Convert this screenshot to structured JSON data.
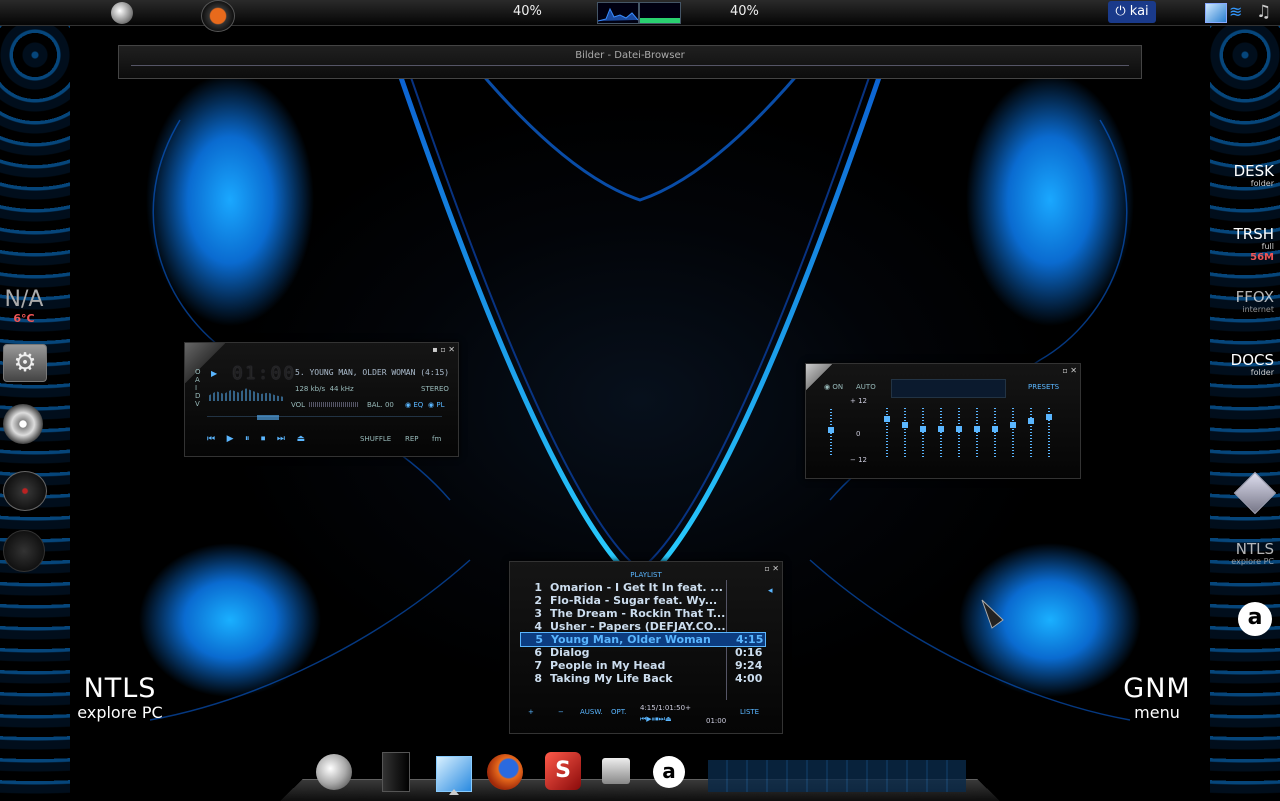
{
  "top_panel": {
    "cpu_left_percent": "40%",
    "cpu_right_percent": "40%",
    "user_name": "kai",
    "icons": [
      "swirl-logo-icon",
      "ubuntu-logo-icon",
      "power-icon",
      "network-icon",
      "wifi-icon",
      "music-icon"
    ]
  },
  "file_browser": {
    "title": "Bilder - Datei-Browser"
  },
  "left_labels": {
    "weather_temp": "N/A",
    "weather_deg": "6°C",
    "ntls_big": "NTLS",
    "ntls_small": "explore PC"
  },
  "right_labels": {
    "gnm_big": "GNM",
    "gnm_small": "menu",
    "ntls_big": "NTLS",
    "ntls_small": "explore PC"
  },
  "right_icons": [
    {
      "big": "DESK",
      "small": "folder"
    },
    {
      "big": "TRSH",
      "small": "full",
      "extra": "56M"
    },
    {
      "big": "FFOX",
      "small": "internet"
    },
    {
      "big": "DOCS",
      "small": "folder"
    }
  ],
  "player": {
    "time": "01:00",
    "track": "5. YOUNG MAN, OLDER WOMAN (4:15)",
    "bitrate": "128",
    "bitrate_unit": "kb/s",
    "khz": "44",
    "khz_unit": "kHz",
    "stereo": "STEREO",
    "vol_label": "VOL",
    "bal_label": "BAL",
    "bal_value": "00",
    "eq_btn": "EQ",
    "pl_btn": "PL",
    "shuffle": "SHUFFLE",
    "rep": "REP"
  },
  "equalizer": {
    "on": "ON",
    "auto": "AUTO",
    "presets": "PRESETS",
    "plus": "+ 12",
    "zero": "0",
    "minus": "− 12"
  },
  "playlist": {
    "title": "PLAYLIST",
    "items": [
      {
        "n": "1",
        "title": "Omarion - I Get It In feat. ...",
        "dur": ""
      },
      {
        "n": "2",
        "title": "Flo-Rida - Sugar feat. Wy...",
        "dur": ""
      },
      {
        "n": "3",
        "title": "The Dream - Rockin That T...",
        "dur": ""
      },
      {
        "n": "4",
        "title": "Usher - Papers (DEFJAY.CO...",
        "dur": ""
      },
      {
        "n": "5",
        "title": "Young Man, Older Woman",
        "dur": "4:15"
      },
      {
        "n": "6",
        "title": "Dialog",
        "dur": "0:16"
      },
      {
        "n": "7",
        "title": "People in My Head",
        "dur": "9:24"
      },
      {
        "n": "8",
        "title": "Taking My Life Back",
        "dur": "4:00"
      }
    ],
    "btn_add": "+",
    "btn_rem": "−",
    "btn_ausw": "AUSW.",
    "btn_opt": "OPT.",
    "total": "4:15/1:01:50+",
    "elapsed": "01:00",
    "btn_liste": "LISTE"
  },
  "dock": {
    "icons": [
      "swirl-logo-icon",
      "black-box-icon",
      "cursor-arrow-icon",
      "firefox-icon",
      "red-s-icon",
      "drive-icon",
      "a-letter-icon"
    ]
  }
}
